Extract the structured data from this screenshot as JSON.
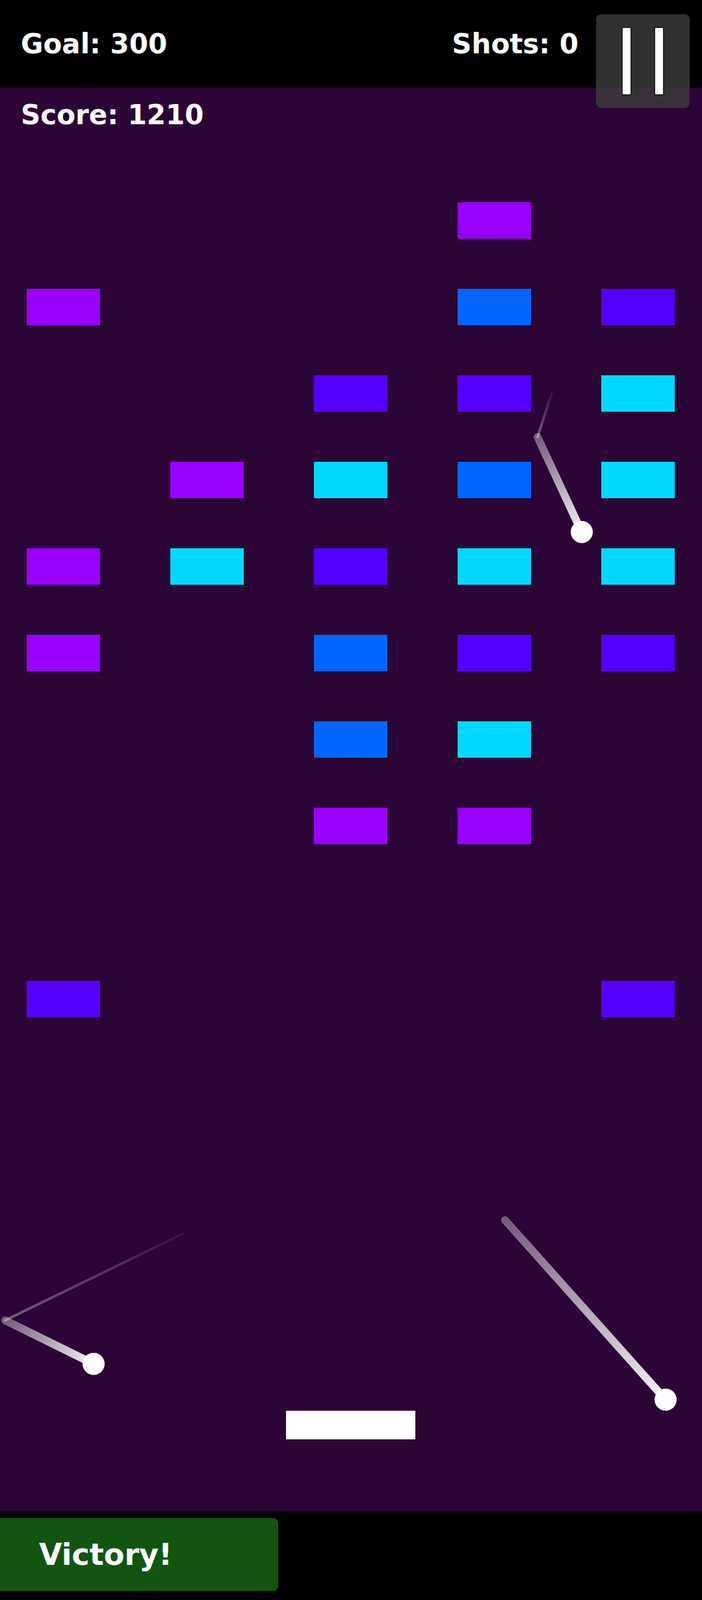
{
  "hud": {
    "goal": "Goal: 300",
    "shots": "Shots: 0",
    "score": "Score: 1210"
  },
  "bricks": [
    [
      null,
      null,
      null,
      "#9900ff",
      null
    ],
    [
      "#9900ff",
      null,
      null,
      "#0066ff",
      "#5500ff"
    ],
    [
      null,
      null,
      "#5500ff",
      "#5500ff",
      "#00d8ff"
    ],
    [
      null,
      "#9900ff",
      "#00d8ff",
      "#0066ff",
      "#00d8ff"
    ],
    [
      "#9900ff",
      "#00d8ff",
      "#5500ff",
      "#00d8ff",
      "#00d8ff"
    ],
    [
      "#9900ff",
      null,
      "#0066ff",
      "#5500ff",
      "#5500ff"
    ],
    [
      null,
      null,
      "#0066ff",
      "#00d8ff",
      null
    ],
    [
      null,
      null,
      "#9900ff",
      "#9900ff",
      null
    ],
    [
      null,
      null,
      null,
      null,
      null
    ],
    [
      "#5500ff",
      null,
      null,
      null,
      "#5500ff"
    ]
  ],
  "victory_button": {
    "label": "Victory!"
  }
}
